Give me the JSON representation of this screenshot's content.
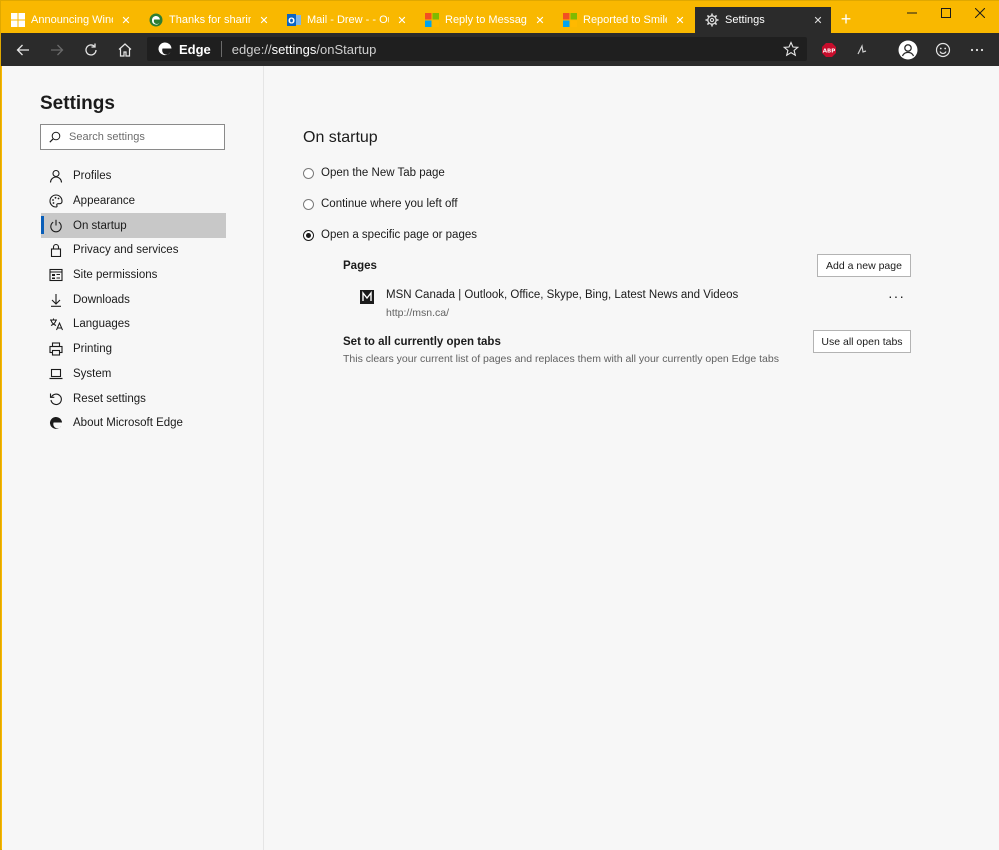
{
  "tabs": [
    {
      "title": "Announcing Window",
      "icon": "windows-logo-icon"
    },
    {
      "title": "Thanks for sharing!",
      "icon": "edge-logo-icon"
    },
    {
      "title": "Mail - Drew - - Outlo",
      "icon": "outlook-logo-icon"
    },
    {
      "title": "Reply to Message - ",
      "icon": "microsoft-logo-icon"
    },
    {
      "title": "Reported to Smiley, ",
      "icon": "microsoft-logo-icon"
    },
    {
      "title": "Settings",
      "icon": "gear-icon"
    }
  ],
  "toolbar": {
    "brand": "Edge",
    "url_prefix": "edge://",
    "url_host": "settings",
    "url_path": "/onStartup"
  },
  "sidebar": {
    "title": "Settings",
    "search_placeholder": "Search settings",
    "items": [
      {
        "label": "Profiles",
        "icon": "person-icon"
      },
      {
        "label": "Appearance",
        "icon": "palette-icon"
      },
      {
        "label": "On startup",
        "icon": "power-icon"
      },
      {
        "label": "Privacy and services",
        "icon": "lock-icon"
      },
      {
        "label": "Site permissions",
        "icon": "site-permissions-icon"
      },
      {
        "label": "Downloads",
        "icon": "download-icon"
      },
      {
        "label": "Languages",
        "icon": "language-icon"
      },
      {
        "label": "Printing",
        "icon": "printer-icon"
      },
      {
        "label": "System",
        "icon": "laptop-icon"
      },
      {
        "label": "Reset settings",
        "icon": "reset-icon"
      },
      {
        "label": "About Microsoft Edge",
        "icon": "edge-logo-icon"
      }
    ],
    "selected": "On startup"
  },
  "main": {
    "heading": "On startup",
    "options": [
      {
        "label": "Open the New Tab page",
        "selected": false
      },
      {
        "label": "Continue where you left off",
        "selected": false
      },
      {
        "label": "Open a specific page or pages",
        "selected": true
      }
    ],
    "pages_label": "Pages",
    "add_page_button": "Add a new page",
    "page_entries": [
      {
        "title": "MSN Canada | Outlook, Office, Skype, Bing, Latest News and Videos",
        "url": "http://msn.ca/",
        "icon": "msn-logo-icon"
      }
    ],
    "more_label": "···",
    "set_tabs_title": "Set to all currently open tabs",
    "set_tabs_desc": "This clears your current list of pages and replaces them with all your currently open Edge tabs",
    "use_tabs_button": "Use all open tabs"
  },
  "colors": {
    "title_bar": "#f9b800",
    "toolbar": "#2b2b2b",
    "accent": "#0a5eb8"
  }
}
